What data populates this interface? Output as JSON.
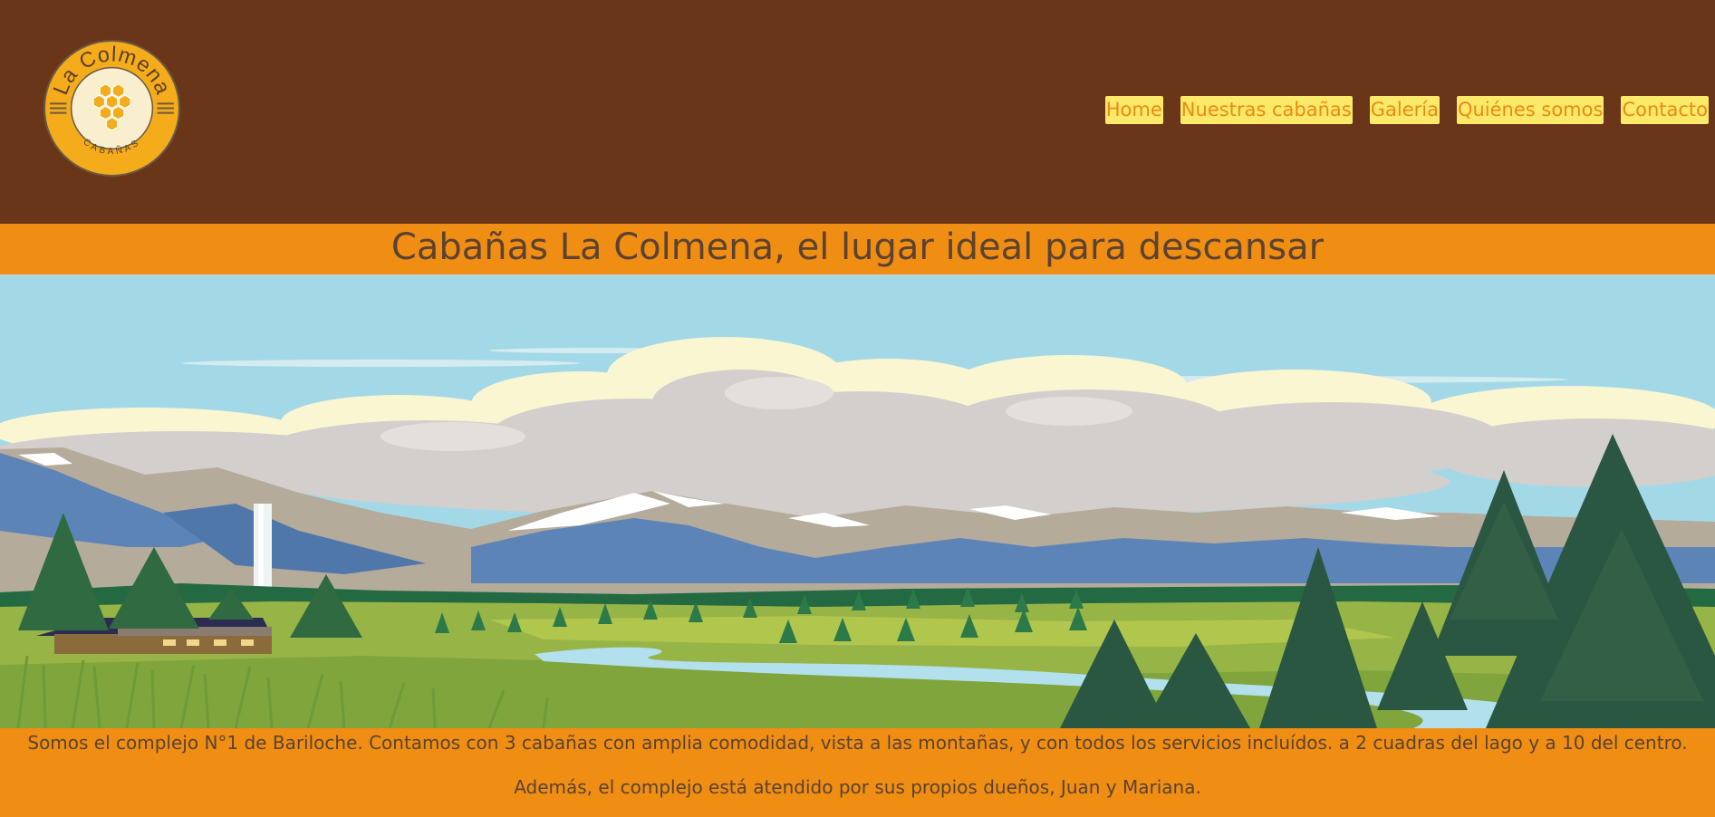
{
  "logo": {
    "name_text": "La Colmena",
    "sub_text": "CABAÑAS"
  },
  "nav": {
    "items": [
      {
        "label": "Home"
      },
      {
        "label": "Nuestras cabañas"
      },
      {
        "label": "Galería"
      },
      {
        "label": "Quiénes somos"
      },
      {
        "label": "Contacto"
      }
    ]
  },
  "banner": {
    "title": "Cabañas La Colmena, el lugar ideal para descansar"
  },
  "description": {
    "line1": "Somos el complejo N°1 de Bariloche. Contamos con 3 cabañas con amplia comodidad, vista a las montañas, y con todos los servicios incluídos. a 2 cuadras del lago y a 10 del centro.",
    "line2": "Además, el complejo está atendido por sus propios dueños, Juan y Mariana."
  },
  "colors": {
    "header_bg": "#6a361a",
    "accent_orange": "#f08e14",
    "nav_bg": "#fbe96a",
    "text_brown": "#5b4231"
  }
}
